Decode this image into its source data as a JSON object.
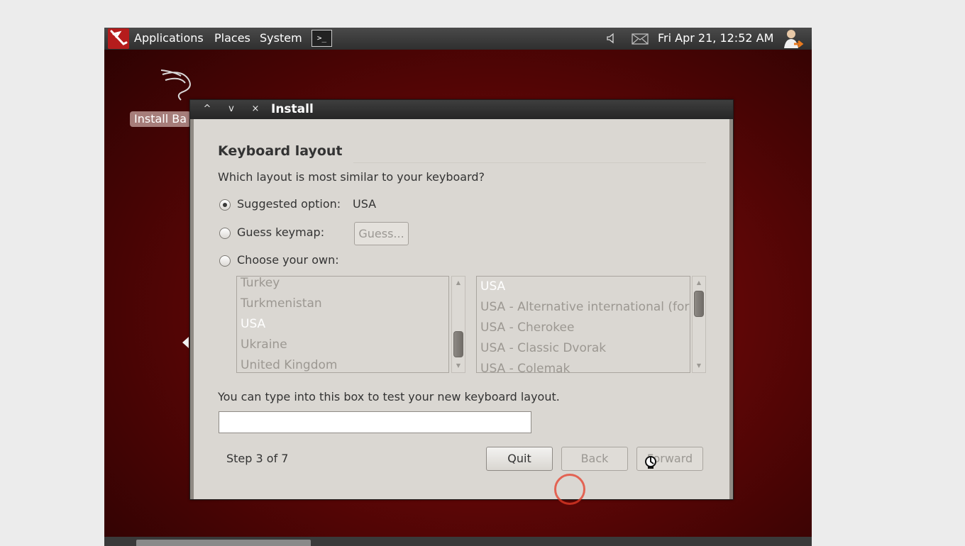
{
  "top_panel": {
    "menus": [
      "Applications",
      "Places",
      "System"
    ],
    "terminal_glyph": ">_",
    "clock": "Fri Apr 21, 12:52 AM"
  },
  "desktop": {
    "icon_label": "Install Ba"
  },
  "window": {
    "title": "Install",
    "controls": {
      "minimize": "^",
      "maximize": "v",
      "close": "×"
    },
    "heading": "Keyboard layout",
    "question": "Which layout is most similar to your keyboard?",
    "suggested": {
      "label": "Suggested option:",
      "value": "USA",
      "selected": true
    },
    "guess": {
      "label": "Guess keymap:",
      "button": "Guess..."
    },
    "choose": {
      "label": "Choose your own:"
    },
    "countries": [
      "Turkey",
      "Turkmenistan",
      "USA",
      "Ukraine",
      "United Kingdom"
    ],
    "countries_selected": "USA",
    "variants": [
      "USA",
      "USA - Alternative international (form",
      "USA - Cherokee",
      "USA - Classic Dvorak",
      "USA - Colemak"
    ],
    "variants_selected": "USA",
    "test_label": "You can type into this box to test your new keyboard layout.",
    "test_value": "",
    "step": "Step 3 of 7",
    "buttons": {
      "quit": "Quit",
      "back": "Back",
      "forward": "Forward"
    }
  },
  "colors": {
    "panel": "#2f2f2f",
    "desktop": "#6e0a0a",
    "dialog": "#dad7d2",
    "click_indicator": "#e63c28"
  }
}
